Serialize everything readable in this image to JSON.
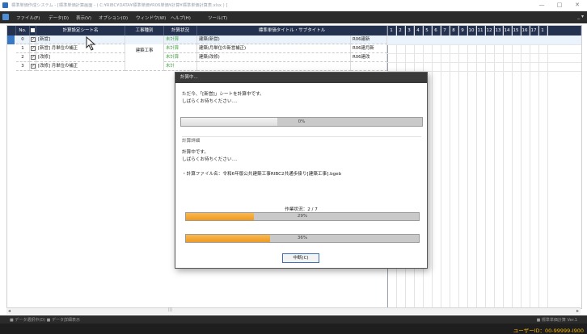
{
  "window": {
    "title": "標準単価作成システム - [標準単価計算画面 - ( C:¥RIBC¥DATA¥標準単価¥R06単価¥計算¥標準単価計算表.xlsx ) ]",
    "minimize": "—",
    "maximize": "□",
    "close": "✕"
  },
  "menu": {
    "items": [
      "ファイル(F)",
      "データ(D)",
      "表示(V)",
      "オプション(O)",
      "ウィンドウ(W)",
      "ヘルプ(H)",
      "ツール(T)"
    ],
    "right_control": "_ ▾"
  },
  "table": {
    "headers": {
      "no": "No.",
      "sheet_name": "計算設定シート名",
      "work_type": "工事種別",
      "calc_status": "計算状況",
      "title": "標準単価タイトル・サブタイトル"
    },
    "number_columns": [
      "1",
      "2",
      "3",
      "4",
      "5",
      "6",
      "7",
      "8",
      "9",
      "10",
      "11",
      "12",
      "13",
      "14",
      "15",
      "16",
      "17",
      "1"
    ],
    "work_type_group": "建築工事",
    "rows": [
      {
        "no": "0",
        "sheet": "[新営]",
        "status": "未計算",
        "title": "建築(新営)",
        "code": "R06建新"
      },
      {
        "no": "1",
        "sheet": "[新営] 月単位の補正",
        "status": "未計算",
        "title": "建築(月単位の新営補正)",
        "code": "R06建月新"
      },
      {
        "no": "2",
        "sheet": "[改修]",
        "status": "未計算",
        "title": "建築(改修)",
        "code": "R06建改"
      },
      {
        "no": "3",
        "sheet": "[改修] 月単位の補正",
        "status": "未計",
        "title": "",
        "code": ""
      }
    ]
  },
  "dialog": {
    "title": "計算中...",
    "message_line1": "ただ今、「[新営]」シートを計算中です。",
    "message_line2": "しばらくお待ちください....",
    "main_progress": {
      "percent": 0,
      "label": "0%"
    },
    "details_heading": "計算詳細",
    "detail_line1": "計算中です。",
    "detail_line2": "しばらくお待ちください....",
    "file_line": "・計算ファイル名：令和6年版公共建築工事RIBC2共通歩掛り[建築工事].bgeb",
    "work_status_label": "作業状況：2 / 7",
    "work_progress": {
      "percent": 29,
      "label": "29%"
    },
    "sub_progress": {
      "percent": 36,
      "label": "36%"
    },
    "cancel_label": "中断(C)"
  },
  "statusbar": {
    "left_text": "■ データ選択中(D)  ■ データ詳細表示",
    "center_text": "|||",
    "right_text": "■ 標準単価計算 Ver.1",
    "user_id": "ユーザーID：00-99999-I900"
  }
}
